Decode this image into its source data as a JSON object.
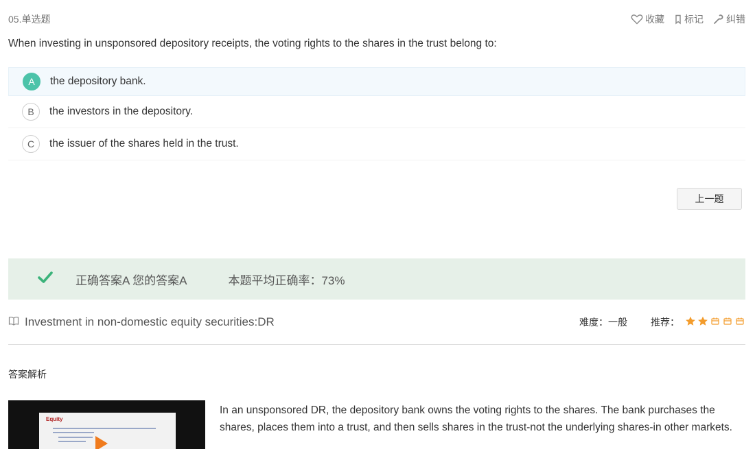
{
  "header": {
    "question_number": "05.单选题",
    "actions": {
      "favorite": "收藏",
      "mark": "标记",
      "report_error": "纠错"
    }
  },
  "question": {
    "text": "When investing in unsponsored depository receipts, the voting rights to the shares in the trust belong to:"
  },
  "options": [
    {
      "letter": "A",
      "text": "the depository bank.",
      "selected": true
    },
    {
      "letter": "B",
      "text": "the investors in the depository.",
      "selected": false
    },
    {
      "letter": "C",
      "text": "the issuer of the shares held in the trust.",
      "selected": false
    }
  ],
  "navigation": {
    "prev_label": "上一题"
  },
  "result": {
    "answer_summary": "正确答案A 您的答案A",
    "average_accuracy": "本题平均正确率：73%",
    "status": "correct",
    "accent_color": "#3bb37a"
  },
  "topic": {
    "title": "Investment in non-domestic equity securities:DR",
    "difficulty_label": "难度：",
    "difficulty_value": "一般",
    "recommend_label": "推荐：",
    "recommend_stars": 2,
    "recommend_max": 5,
    "star_color": "#f39c2c"
  },
  "analysis": {
    "title": "答案解析",
    "video_slide_title": "Equity",
    "explanation": "In an unsponsored DR, the depository bank owns the voting rights to the shares. The bank purchases the shares, places them into a trust, and then sells shares in the trust-not the underlying shares-in other markets."
  }
}
